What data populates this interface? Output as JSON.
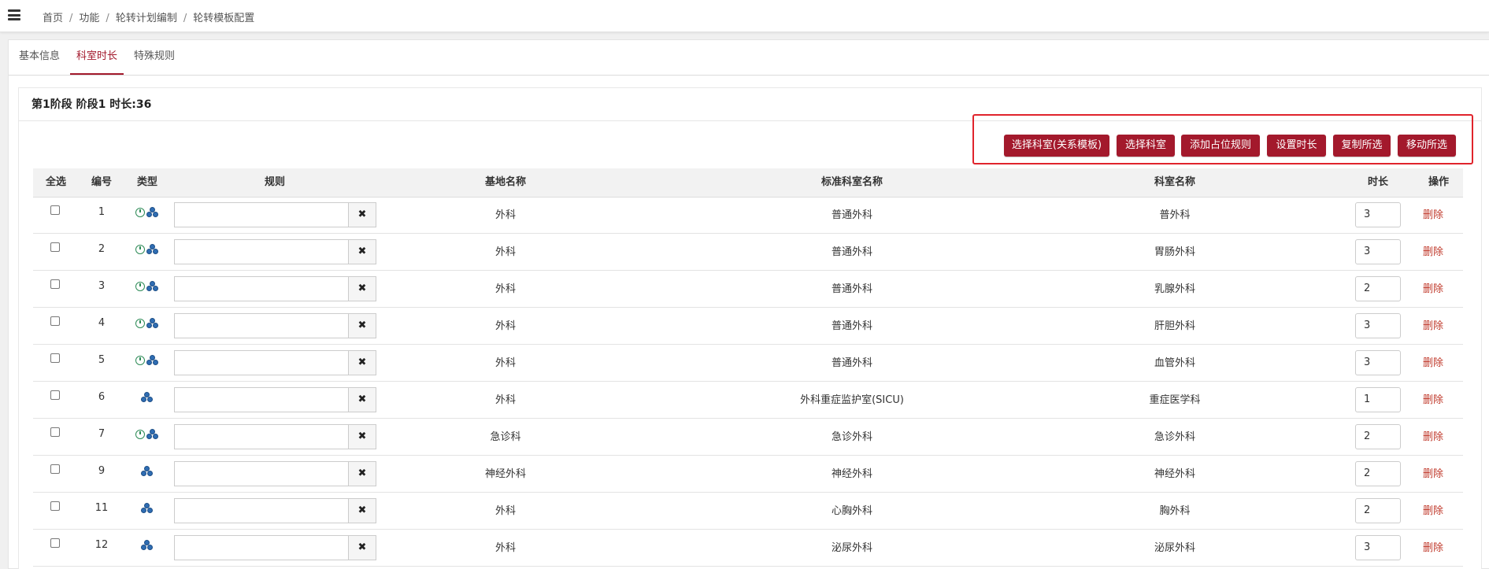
{
  "breadcrumb": [
    "首页",
    "功能",
    "轮转计划编制",
    "轮转模板配置"
  ],
  "tabs": [
    "基本信息",
    "科室时长",
    "特殊规则"
  ],
  "active_tab": "科室时长",
  "stage_title": "第1阶段 阶段1 时长:36",
  "toolbar": {
    "buttons": [
      "选择科室(关系模板)",
      "选择科室",
      "添加占位规则",
      "设置时长",
      "复制所选",
      "移动所选"
    ]
  },
  "table": {
    "headers": {
      "select_all": "全选",
      "number": "编号",
      "type": "类型",
      "rule": "规则",
      "base_name": "基地名称",
      "standard_dept": "标准科室名称",
      "dept_name": "科室名称",
      "duration": "时长",
      "action": "操作"
    },
    "clear_symbol": "✖",
    "delete_label": "删除",
    "rows": [
      {
        "no": "1",
        "icons": [
          "clock-icon",
          "people-icon"
        ],
        "base": "外科",
        "standard": "普通外科",
        "dept": "普外科",
        "duration": "3"
      },
      {
        "no": "2",
        "icons": [
          "clock-icon",
          "people-icon"
        ],
        "base": "外科",
        "standard": "普通外科",
        "dept": "胃肠外科",
        "duration": "3"
      },
      {
        "no": "3",
        "icons": [
          "clock-icon",
          "people-icon"
        ],
        "base": "外科",
        "standard": "普通外科",
        "dept": "乳腺外科",
        "duration": "2"
      },
      {
        "no": "4",
        "icons": [
          "clock-icon",
          "people-icon"
        ],
        "base": "外科",
        "standard": "普通外科",
        "dept": "肝胆外科",
        "duration": "3"
      },
      {
        "no": "5",
        "icons": [
          "clock-icon",
          "people-icon"
        ],
        "base": "外科",
        "standard": "普通外科",
        "dept": "血管外科",
        "duration": "3"
      },
      {
        "no": "6",
        "icons": [
          "people-icon"
        ],
        "base": "外科",
        "standard": "外科重症监护室(SICU)",
        "dept": "重症医学科",
        "duration": "1"
      },
      {
        "no": "7",
        "icons": [
          "clock-icon",
          "people-icon"
        ],
        "base": "急诊科",
        "standard": "急诊外科",
        "dept": "急诊外科",
        "duration": "2"
      },
      {
        "no": "9",
        "icons": [
          "people-icon"
        ],
        "base": "神经外科",
        "standard": "神经外科",
        "dept": "神经外科",
        "duration": "2"
      },
      {
        "no": "11",
        "icons": [
          "people-icon"
        ],
        "base": "外科",
        "standard": "心胸外科",
        "dept": "胸外科",
        "duration": "2"
      },
      {
        "no": "12",
        "icons": [
          "people-icon"
        ],
        "base": "外科",
        "standard": "泌尿外科",
        "dept": "泌尿外科",
        "duration": "3"
      }
    ]
  }
}
